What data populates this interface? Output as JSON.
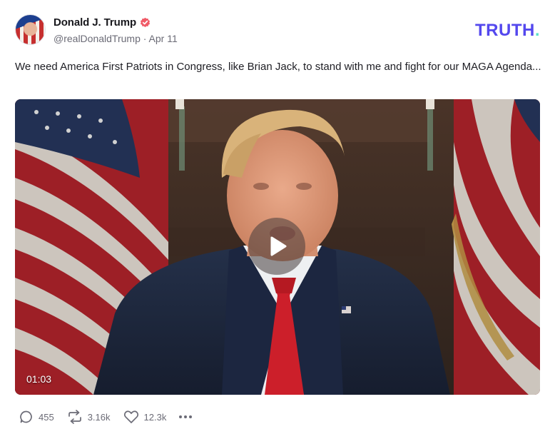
{
  "author": {
    "display_name": "Donald J. Trump",
    "handle": "@realDonaldTrump",
    "separator": "·",
    "date": "Apr 11"
  },
  "brand": {
    "word": "TRUTH",
    "dot": "."
  },
  "post": {
    "text": "We need America First Patriots in Congress, like Brian Jack, to stand with me and fight for our MAGA Agenda..."
  },
  "video": {
    "duration": "01:03"
  },
  "actions": {
    "replies": "455",
    "retruths": "3.16k",
    "likes": "12.3k"
  },
  "colors": {
    "brand": "#5448ee",
    "brand_dot": "#5ce2c9",
    "verified": "#f05a67",
    "muted": "#6b6b76"
  },
  "icons": [
    "verified-badge-icon",
    "play-icon",
    "reply-icon",
    "retruth-icon",
    "like-icon",
    "more-icon"
  ]
}
